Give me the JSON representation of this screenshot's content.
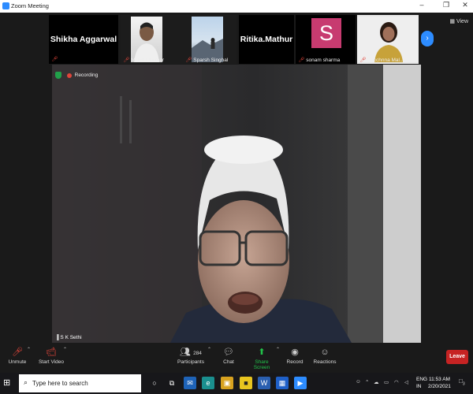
{
  "window": {
    "title": "Zoom Meeting",
    "minimize_glyph": "–",
    "maximize_glyph": "❐",
    "close_glyph": "✕"
  },
  "gallery": {
    "view_label": "View",
    "next_glyph": "›",
    "tiles": [
      {
        "display": "Shikha Aggarwal",
        "footer": ""
      },
      {
        "display": "",
        "footer": "MOHIT Kumar"
      },
      {
        "display": "",
        "footer": "Sparsh Singhal"
      },
      {
        "display": "Ritika.Mathur",
        "footer": ""
      },
      {
        "display": "S",
        "footer": "sonam sharma"
      },
      {
        "display": "",
        "footer": "Yacchnna Mal..."
      }
    ]
  },
  "main_video": {
    "recording_label": "Recording",
    "speaker_name": "S K Sethi"
  },
  "toolbar": {
    "unmute": "Unmute",
    "start_video": "Start Video",
    "participants": "Participants",
    "participants_count": "284",
    "chat": "Chat",
    "share_screen": "Share Screen",
    "record": "Record",
    "reactions": "Reactions",
    "leave": "Leave"
  },
  "taskbar": {
    "search_placeholder": "Type here to search",
    "language_top": "ENG",
    "language_bottom": "IN",
    "time": "11:53 AM",
    "date": "2/20/2021",
    "notification_count": "3"
  },
  "colors": {
    "zoom_blue": "#2d8cff",
    "leave_red": "#c62323",
    "share_green": "#21c24a",
    "avatar_pink": "#c73b70"
  }
}
